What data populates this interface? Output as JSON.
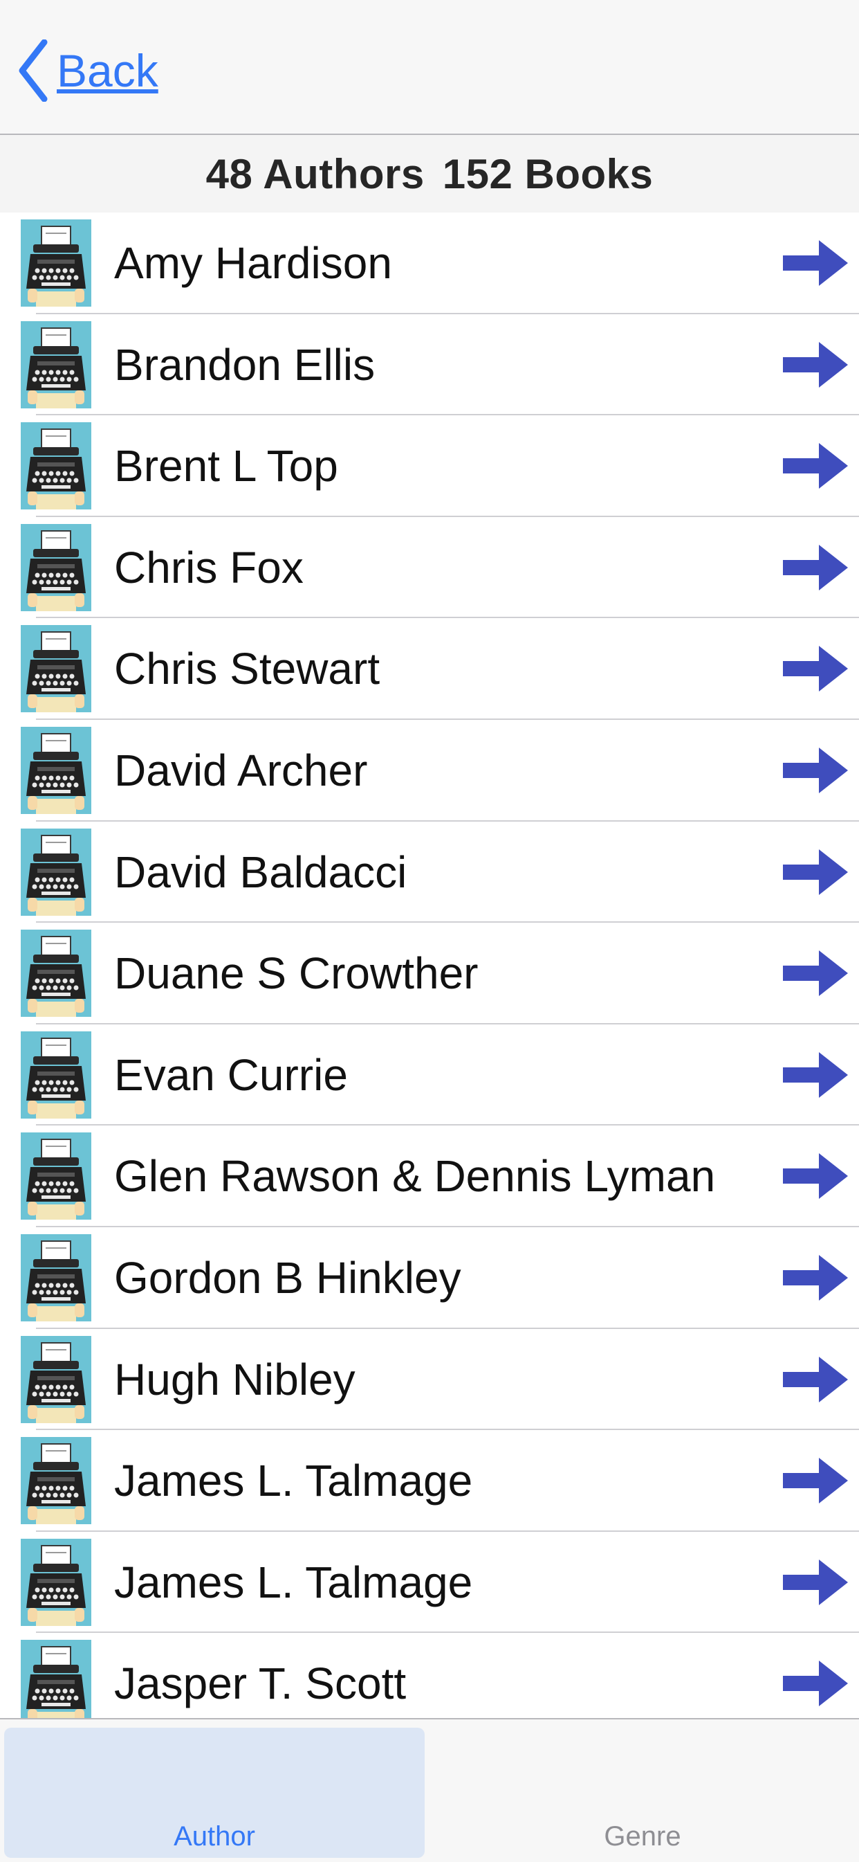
{
  "nav": {
    "back_label": "Back"
  },
  "summary": {
    "authors": "48 Authors",
    "books": "152 Books"
  },
  "authors": [
    {
      "name": "Amy Hardison"
    },
    {
      "name": "Brandon Ellis"
    },
    {
      "name": "Brent L Top"
    },
    {
      "name": "Chris Fox"
    },
    {
      "name": "Chris Stewart"
    },
    {
      "name": "David Archer"
    },
    {
      "name": "David Baldacci"
    },
    {
      "name": "Duane S Crowther"
    },
    {
      "name": "Evan Currie"
    },
    {
      "name": "Glen Rawson & Dennis Lyman"
    },
    {
      "name": "Gordon B Hinkley"
    },
    {
      "name": "Hugh Nibley"
    },
    {
      "name": "James L. Talmage"
    },
    {
      "name": "James L. Talmage"
    },
    {
      "name": "Jasper T. Scott"
    }
  ],
  "icons": {
    "author_thumb": "typewriter-icon",
    "row_action": "right-arrow-icon",
    "back": "chevron-left-icon"
  },
  "colors": {
    "accent": "#3478f6",
    "arrow": "#3f4dbd",
    "thumb_bg": "#6cc3d5"
  },
  "tabs": [
    {
      "label": "Author",
      "selected": true
    },
    {
      "label": "Genre",
      "selected": false
    }
  ]
}
